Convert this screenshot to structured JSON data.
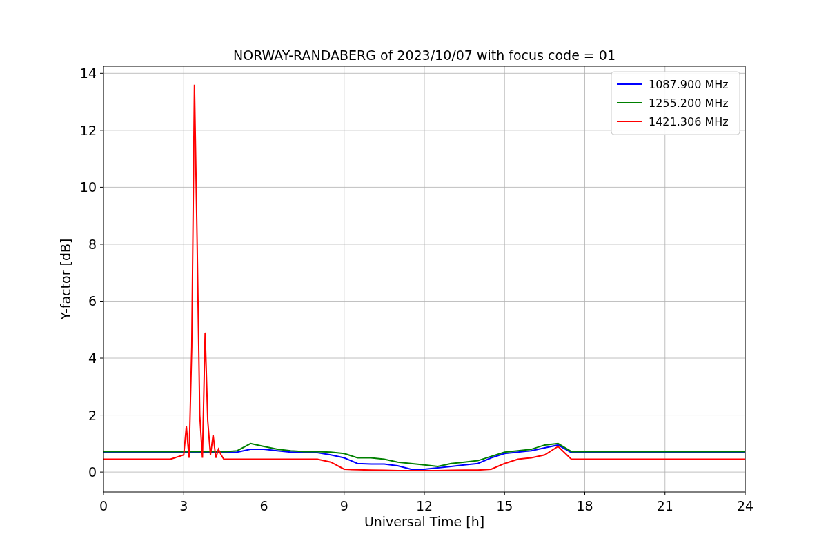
{
  "chart": {
    "chart_data": {
      "type": "line",
      "title": "NORWAY-RANDABERG of 2023/10/07 with focus code = 01",
      "xlabel": "Universal Time [h]",
      "ylabel": "Y-factor [dB]",
      "x": [
        0,
        0.5,
        1,
        1.5,
        2,
        2.5,
        3.0,
        3.1,
        3.2,
        3.3,
        3.4,
        3.5,
        3.6,
        3.7,
        3.8,
        3.9,
        4.0,
        4.1,
        4.2,
        4.3,
        4.4,
        4.5,
        4.6,
        5,
        5.5,
        6,
        6.5,
        7,
        7.5,
        8,
        8.5,
        9,
        9.5,
        10,
        10.5,
        11,
        11.5,
        12,
        12.5,
        13,
        13.5,
        14,
        14.5,
        15,
        15.5,
        16,
        16.5,
        17,
        17.5,
        18,
        18.5,
        19,
        19.5,
        20,
        20.5,
        21,
        21.5,
        22,
        22.5,
        23,
        23.5,
        24
      ],
      "series": [
        {
          "name": "1087.900 MHz",
          "color": "#0000ff",
          "values": [
            0.68,
            0.68,
            0.68,
            0.68,
            0.68,
            0.68,
            0.68,
            0.68,
            0.68,
            0.68,
            0.68,
            0.68,
            0.68,
            0.68,
            0.68,
            0.68,
            0.68,
            0.68,
            0.68,
            0.68,
            0.68,
            0.68,
            0.68,
            0.7,
            0.8,
            0.8,
            0.75,
            0.7,
            0.7,
            0.68,
            0.6,
            0.5,
            0.3,
            0.28,
            0.28,
            0.22,
            0.1,
            0.1,
            0.15,
            0.2,
            0.25,
            0.3,
            0.5,
            0.65,
            0.7,
            0.75,
            0.85,
            0.95,
            0.68,
            0.68,
            0.68,
            0.68,
            0.68,
            0.68,
            0.68,
            0.68,
            0.68,
            0.68,
            0.68,
            0.68,
            0.68,
            0.68
          ]
        },
        {
          "name": "1255.200 MHz",
          "color": "#008000",
          "values": [
            0.72,
            0.72,
            0.72,
            0.72,
            0.72,
            0.72,
            0.72,
            0.72,
            0.72,
            0.72,
            0.72,
            0.72,
            0.72,
            0.72,
            0.72,
            0.72,
            0.72,
            0.72,
            0.72,
            0.72,
            0.72,
            0.72,
            0.72,
            0.75,
            1.0,
            0.9,
            0.8,
            0.75,
            0.72,
            0.72,
            0.7,
            0.65,
            0.5,
            0.5,
            0.45,
            0.35,
            0.3,
            0.25,
            0.2,
            0.3,
            0.35,
            0.4,
            0.55,
            0.7,
            0.75,
            0.8,
            0.95,
            1.0,
            0.72,
            0.72,
            0.72,
            0.72,
            0.72,
            0.72,
            0.72,
            0.72,
            0.72,
            0.72,
            0.72,
            0.72,
            0.72,
            0.72
          ]
        },
        {
          "name": "1421.306 MHz",
          "color": "#ff0000",
          "values": [
            0.45,
            0.45,
            0.45,
            0.45,
            0.45,
            0.45,
            0.6,
            1.6,
            0.5,
            4.4,
            13.6,
            8.2,
            2.0,
            0.5,
            4.9,
            1.8,
            0.6,
            1.3,
            0.5,
            0.8,
            0.6,
            0.45,
            0.45,
            0.45,
            0.45,
            0.45,
            0.45,
            0.45,
            0.45,
            0.45,
            0.35,
            0.1,
            0.08,
            0.07,
            0.06,
            0.05,
            0.05,
            0.05,
            0.05,
            0.06,
            0.07,
            0.07,
            0.1,
            0.3,
            0.45,
            0.5,
            0.6,
            0.9,
            0.45,
            0.45,
            0.45,
            0.45,
            0.45,
            0.45,
            0.45,
            0.45,
            0.45,
            0.45,
            0.45,
            0.45,
            0.45,
            0.45
          ]
        }
      ],
      "grid": true,
      "legend": "upper right",
      "xlim": [
        0,
        24
      ],
      "ylim": [
        -0.7,
        14.25
      ],
      "xticks": [
        0,
        3,
        6,
        9,
        12,
        15,
        18,
        21,
        24
      ],
      "yticks": [
        0,
        2,
        4,
        6,
        8,
        10,
        12,
        14
      ]
    }
  }
}
